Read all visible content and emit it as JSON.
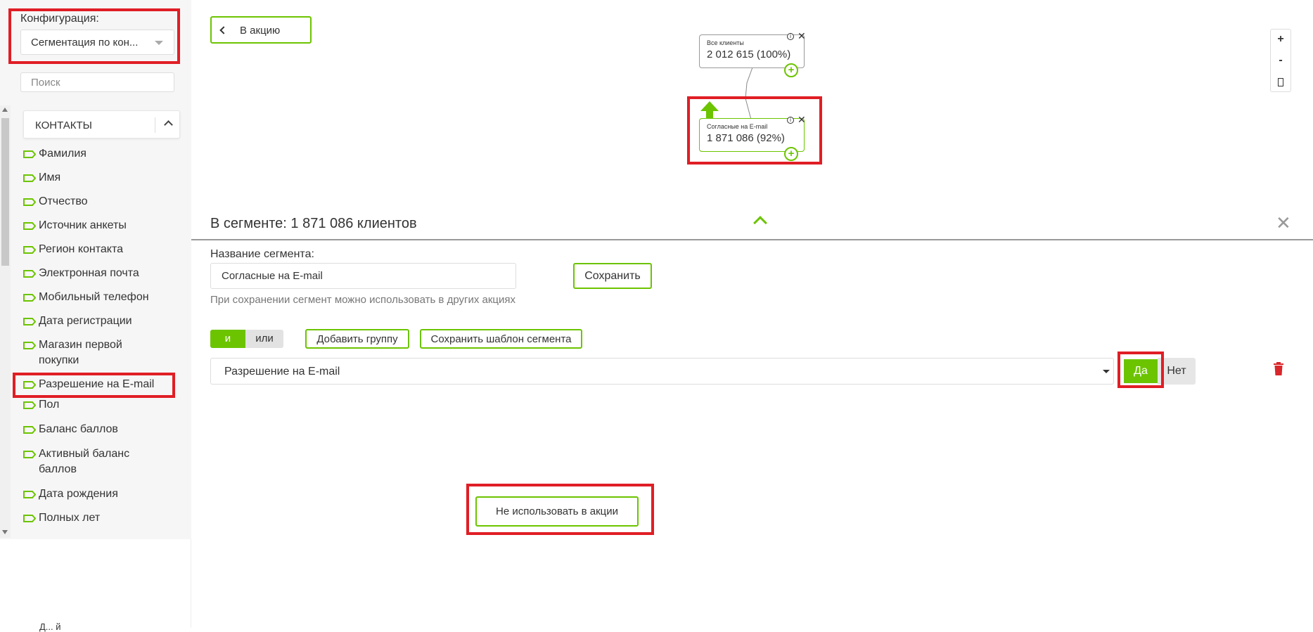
{
  "sidebar": {
    "config_label": "Конфигурация:",
    "config_value": "Сегментация по кон...",
    "search_placeholder": "Поиск",
    "section_title": "КОНТАКТЫ",
    "fields": [
      "Фамилия",
      "Имя",
      "Отчество",
      "Источник анкеты",
      "Регион контакта",
      "Электронная почта",
      "Мобильный телефон",
      "Дата регистрации",
      "Магазин первой покупки",
      "Разрешение на E-mail",
      "Пол",
      "Баланс баллов",
      "Активный баланс баллов",
      "Дата рождения",
      "Полных лет"
    ],
    "bottom_text": "Д...        й"
  },
  "header": {
    "back_label": "В акцию"
  },
  "tree": {
    "root": {
      "title": "Все клиенты",
      "value": "2 012 615 (100%)"
    },
    "child": {
      "title": "Согласные на E-mail",
      "value": "1 871 086 (92%)"
    }
  },
  "zoom": {
    "plus": "+",
    "minus": "-"
  },
  "segment": {
    "title": "В сегменте: 1 871 086 клиентов",
    "name_label": "Название сегмента:",
    "name_value": "Согласные на E-mail",
    "save_label": "Сохранить",
    "hint": "При сохранении сегмент можно использовать в других акциях",
    "and_label": "и",
    "or_label": "или",
    "add_group_label": "Добавить группу",
    "save_template_label": "Сохранить шаблон сегмента",
    "condition_value": "Разрешение на E-mail",
    "yes_label": "Да",
    "no_label": "Нет",
    "not_use_label": "Не использовать в акции"
  },
  "colors": {
    "accent": "#6cc400",
    "highlight": "#e01e25",
    "trash": "#d9262a"
  }
}
